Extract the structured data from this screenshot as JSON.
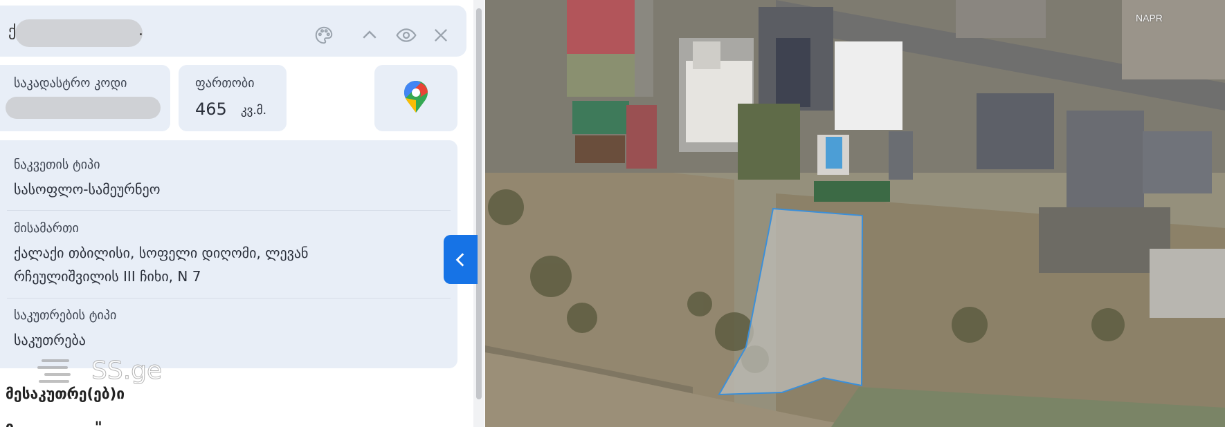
{
  "header": {
    "title_prefix": "ქ",
    "title_suffix": ".",
    "icons": [
      "palette-icon",
      "chevron-up-icon",
      "eye-icon",
      "close-icon"
    ]
  },
  "cadastral": {
    "label": "საკადასტრო კოდი"
  },
  "area": {
    "label": "ფართობი",
    "value": "465",
    "unit": "კვ.მ."
  },
  "map_link": {
    "icon": "google-maps-pin-icon"
  },
  "info": {
    "parcel_type_label": "ნაკვეთის ტიპი",
    "parcel_type_value": "სასოფლო-სამეურნეო",
    "address_label": "მისამართი",
    "address_line1": "ქალაქი თბილისი, სოფელი დიღომი, ლევან",
    "address_line2": "რჩეულიშვილის III ჩიხი, N 7",
    "ownership_label": "საკუთრების ტიპი",
    "ownership_value": "საკუთრება"
  },
  "owners_label": "მესაკუთრე(ებ)ი",
  "watermark": {
    "text": "SS.ge"
  },
  "map": {
    "label": "NAPR"
  },
  "colors": {
    "accent": "#1673e6",
    "card": "#e8eef7",
    "parcel_outline": "#3b8fd9"
  }
}
